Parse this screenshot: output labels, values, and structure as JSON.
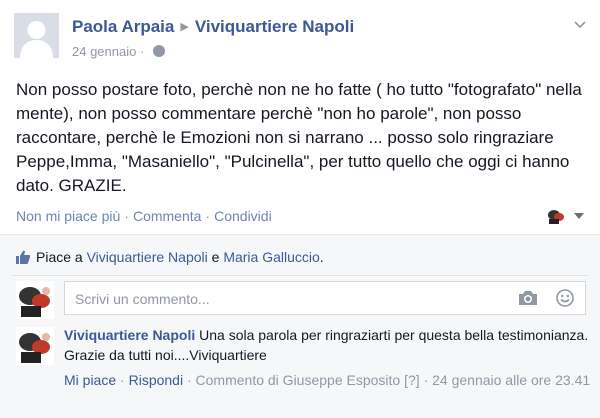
{
  "post": {
    "author": "Paola Arpaia",
    "page": "Viviquartiere Napoli",
    "date": "24 gennaio",
    "separator": "·",
    "text": "Non posso postare foto, perchè non ne ho fatte ( ho tutto \"fotografato\" nella mente), non posso commentare perchè \"non ho parole\", non posso raccontare, perchè le Emozioni non si narrano ... posso solo ringraziare Peppe,Imma, \"Masaniello\", \"Pulcinella\", per tutto quello che oggi ci hanno dato. GRAZIE.",
    "actions": {
      "unlike": "Non mi piace più",
      "comment": "Commenta",
      "share": "Condividi",
      "sep": "·"
    }
  },
  "ufi": {
    "likes": {
      "prefix": "Piace a",
      "user1": "Viviquartiere Napoli",
      "conj": "e",
      "user2": "Maria Galluccio",
      "suffix": "."
    },
    "comment_box": {
      "placeholder": "Scrivi un commento..."
    },
    "reply": {
      "author": "Viviquartiere Napoli",
      "text": "Una sola parola per ringraziarti per questa bella testimonianza. Grazie da tutti noi....Viviquartiere",
      "like": "Mi piace",
      "reply": "Rispondi",
      "sep": "·",
      "meta_prefix": "Commento di Giuseppe Esposito",
      "meta_flag": "[?]",
      "timestamp": "24 gennaio alle ore 23.41"
    }
  },
  "icons": {
    "globe": "globe-icon",
    "chevron": "chevron-down-icon",
    "like": "thumbs-up-icon",
    "camera": "camera-icon",
    "smile": "smiley-icon"
  },
  "colors": {
    "link": "#3b5998",
    "muted": "#9197a3",
    "ufi_bg": "#f6f7f9"
  }
}
